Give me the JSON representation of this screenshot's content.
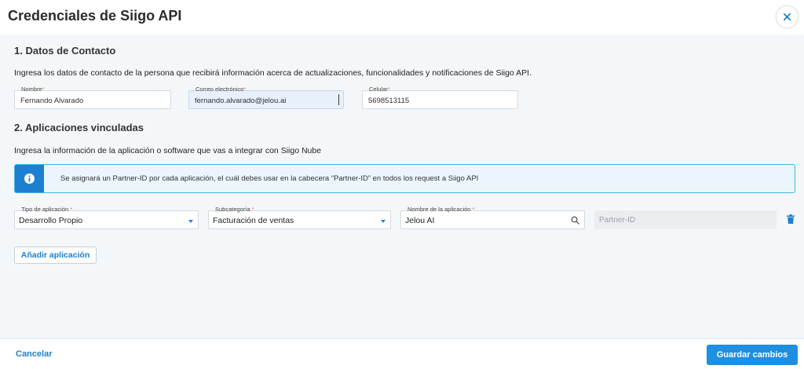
{
  "header": {
    "title": "Credenciales de Siigo API",
    "close_icon": "close-icon"
  },
  "contact": {
    "section_title": "1. Datos de Contacto",
    "description": "Ingresa los datos de contacto de la persona que recibirá información acerca de actualizaciones, funcionalidades y notificaciones de Siigo API.",
    "nombre": {
      "label": "Nombre",
      "value": "Fernando Alvarado"
    },
    "correo": {
      "label": "Correo electrónico",
      "value": "fernando.alvarado@jelou.ai"
    },
    "celular": {
      "label": "Celular",
      "value": "5698513115"
    },
    "required_mark": "*"
  },
  "apps": {
    "section_title": "2. Aplicaciones vinculadas",
    "description": "Ingresa la información de la aplicación o software que vas a integrar con Siigo Nube",
    "info_icon": "info-icon",
    "info_message": "Se asignará un Partner-ID por cada aplicación, el cuál debes usar en la cabecera “Partner-ID” en todos los request a Siigo API",
    "tipo": {
      "label": "Tipo de aplicación",
      "value": "Desarrollo Propio"
    },
    "subcategoria": {
      "label": "Subcategoría",
      "value": "Facturación de ventas"
    },
    "nombre_app": {
      "label": "Nombre de la aplicación",
      "value": "Jelou AI"
    },
    "partner_placeholder": "Partner-ID",
    "add_label": "Añadir aplicación",
    "delete_icon": "trash-icon"
  },
  "footer": {
    "cancel_label": "Cancelar",
    "save_label": "Guardar cambios"
  },
  "colors": {
    "accent": "#1c80d1",
    "required": "#e8772e",
    "info_border": "#45b2e4",
    "save_button": "#1e8fe1"
  }
}
